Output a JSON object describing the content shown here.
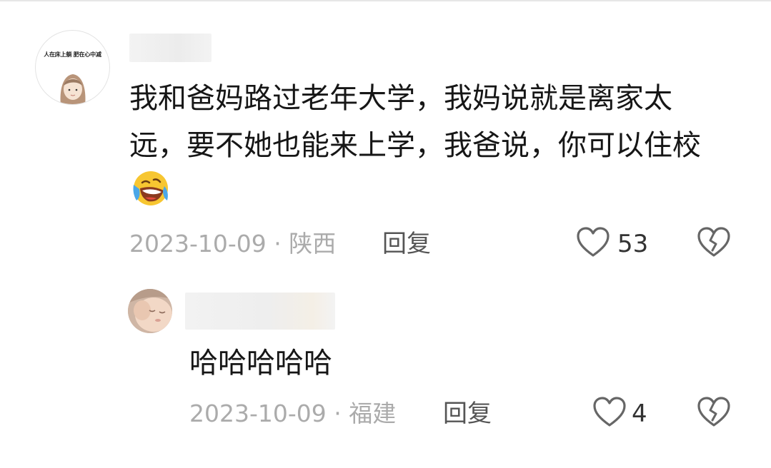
{
  "comment": {
    "author_avatar_text": "人在床上躺 肥在心中减",
    "text": "我和爸妈路过老年大学，我妈说就是离家太远，要不她也能来上学，我爸说，你可以住校",
    "emoji": "laughing-crying-emoji",
    "date": "2023-10-09",
    "location": "陕西",
    "separator": " · ",
    "reply_label": "回复",
    "likes": "53"
  },
  "reply": {
    "text": "哈哈哈哈哈",
    "date": "2023-10-09",
    "location": "福建",
    "separator": " · ",
    "reply_label": "回复",
    "likes": "4"
  },
  "colors": {
    "text": "#161616",
    "meta": "#ababab",
    "icon": "#666666"
  }
}
